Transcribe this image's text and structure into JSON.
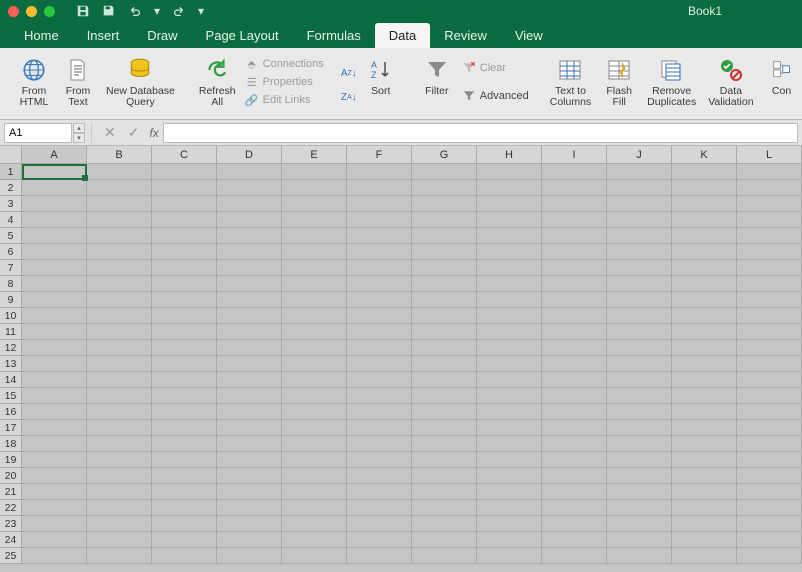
{
  "window": {
    "title": "Book1"
  },
  "tabs": {
    "items": [
      "Home",
      "Insert",
      "Draw",
      "Page Layout",
      "Formulas",
      "Data",
      "Review",
      "View"
    ],
    "active": "Data"
  },
  "ribbon": {
    "fromHtml": "From\nHTML",
    "fromText": "From\nText",
    "newDbQuery": "New Database\nQuery",
    "refreshAll": "Refresh\nAll",
    "connections": "Connections",
    "properties": "Properties",
    "editLinks": "Edit Links",
    "sort": "Sort",
    "filter": "Filter",
    "clear": "Clear",
    "advanced": "Advanced",
    "textToCols": "Text to\nColumns",
    "flashFill": "Flash\nFill",
    "removeDup": "Remove\nDuplicates",
    "dataValidation": "Data\nValidation",
    "consolidate": "Con"
  },
  "formula": {
    "nameBox": "A1",
    "fx": "fx"
  },
  "sheet": {
    "columns": [
      "A",
      "B",
      "C",
      "D",
      "E",
      "F",
      "G",
      "H",
      "I",
      "J",
      "K",
      "L"
    ],
    "rowCount": 25,
    "activeCell": "A1"
  }
}
